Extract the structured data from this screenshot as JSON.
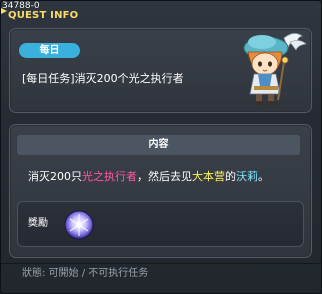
{
  "quest_id": "34788-0",
  "title": "QUEST INFO",
  "badge": "每日",
  "quest_name": "[每日任务]消灭200个光之执行者",
  "content": {
    "header": "内容",
    "segments": [
      {
        "text": "消灭200只",
        "color": "#ffffff"
      },
      {
        "text": "光之执行者",
        "color": "#ff5aa6"
      },
      {
        "text": "，然后去见",
        "color": "#ffffff"
      },
      {
        "text": "大本营",
        "color": "#fff45a"
      },
      {
        "text": "的",
        "color": "#ffffff"
      },
      {
        "text": "沃莉",
        "color": "#7fe7ff"
      },
      {
        "text": "。",
        "color": "#ffffff"
      }
    ]
  },
  "reward": {
    "label": "獎勵",
    "icon": "light-orb-icon"
  },
  "status": "狀態: 可開始 / 不可执行任务",
  "colors": {
    "title": "#f6dc69",
    "badge": "#3ab0dd",
    "status_text": "#9aa1aa"
  }
}
